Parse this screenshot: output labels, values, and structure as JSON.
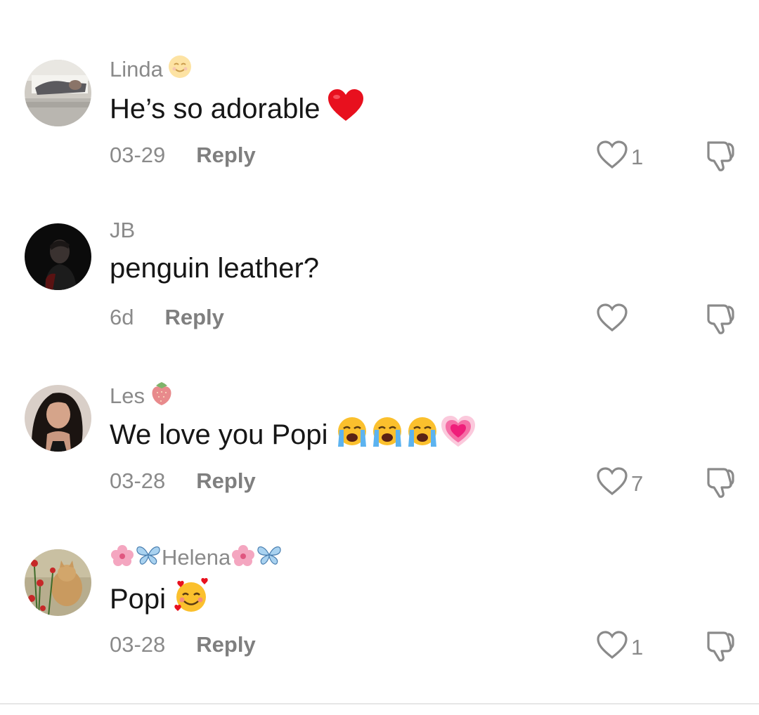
{
  "comments": [
    {
      "username": "Linda",
      "username_emoji": "smiling-face-emoji",
      "text": "He’s so adorable",
      "text_emojis": [
        "red-heart-emoji"
      ],
      "date": "03-29",
      "reply_label": "Reply",
      "like_count": "1"
    },
    {
      "username": "JB",
      "username_emoji": "",
      "text": "penguin leather?",
      "text_emojis": [],
      "date": "6d",
      "reply_label": "Reply",
      "like_count": ""
    },
    {
      "username": "Les",
      "username_emoji": "strawberry-emoji",
      "text": "We love you Popi",
      "text_emojis": [
        "loudly-crying-face-emoji",
        "loudly-crying-face-emoji",
        "loudly-crying-face-emoji",
        "growing-heart-emoji"
      ],
      "date": "03-28",
      "reply_label": "Reply",
      "like_count": "7"
    },
    {
      "username": "Helena",
      "username_emoji": "hibiscus-butterfly-emojis",
      "text": "Popi",
      "text_emojis": [
        "smiling-face-with-hearts-emoji"
      ],
      "date": "03-28",
      "reply_label": "Reply",
      "like_count": "1"
    }
  ],
  "colors": {
    "text": "#161616",
    "muted": "#8a8a8a",
    "divider": "#e6e6e6"
  }
}
